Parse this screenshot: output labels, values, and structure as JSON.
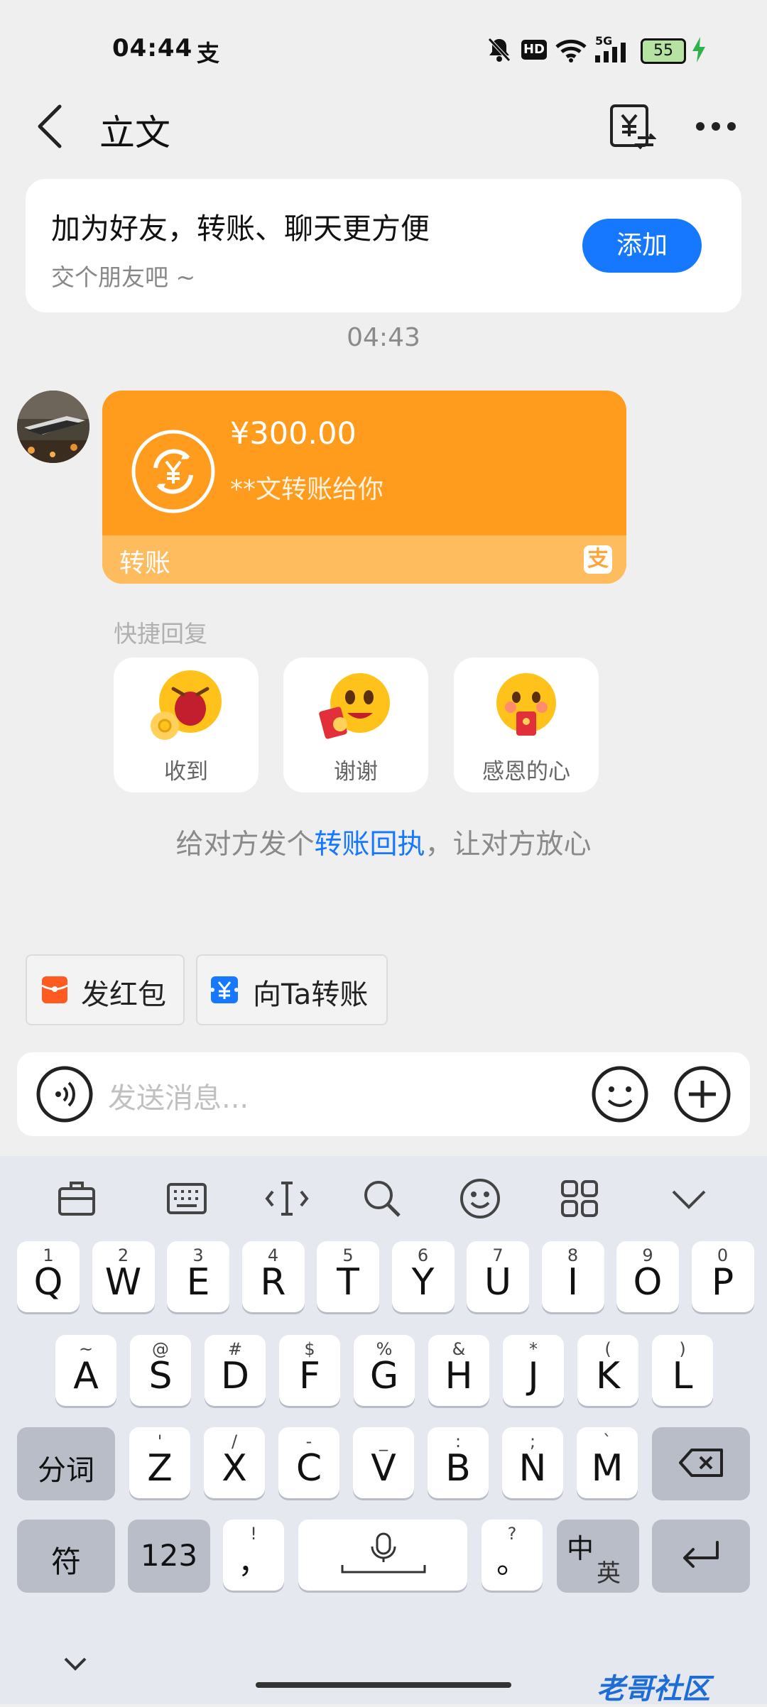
{
  "status_bar": {
    "time": "04:44",
    "alipay_glyph": "支",
    "battery": "55",
    "network": "5G",
    "hd": "HD"
  },
  "header": {
    "title": "立文"
  },
  "add_friend": {
    "title": "加为好友，转账、聊天更方便",
    "subtitle": "交个朋友吧 ~",
    "button": "添加"
  },
  "chat": {
    "timestamp": "04:43",
    "transfer": {
      "amount": "¥300.00",
      "desc": "**文转账给你",
      "label": "转账"
    },
    "quick_reply_label": "快捷回复",
    "quick_replies": [
      "收到",
      "谢谢",
      "感恩的心"
    ],
    "receipt_hint": {
      "before": "给对方发个",
      "link": "转账回执",
      "after": "，让对方放心"
    }
  },
  "actions": {
    "red_packet": "发红包",
    "transfer_to": "向Ta转账"
  },
  "input": {
    "placeholder": "发送消息..."
  },
  "keyboard": {
    "row1": [
      {
        "m": "Q",
        "s": "1"
      },
      {
        "m": "W",
        "s": "2"
      },
      {
        "m": "E",
        "s": "3"
      },
      {
        "m": "R",
        "s": "4"
      },
      {
        "m": "T",
        "s": "5"
      },
      {
        "m": "Y",
        "s": "6"
      },
      {
        "m": "U",
        "s": "7"
      },
      {
        "m": "I",
        "s": "8"
      },
      {
        "m": "O",
        "s": "9"
      },
      {
        "m": "P",
        "s": "0"
      }
    ],
    "row2": [
      {
        "m": "A",
        "s": "~"
      },
      {
        "m": "S",
        "s": "@"
      },
      {
        "m": "D",
        "s": "#"
      },
      {
        "m": "F",
        "s": "$"
      },
      {
        "m": "G",
        "s": "%"
      },
      {
        "m": "H",
        "s": "&"
      },
      {
        "m": "J",
        "s": "*"
      },
      {
        "m": "K",
        "s": "("
      },
      {
        "m": "L",
        "s": ")"
      }
    ],
    "row3": [
      {
        "m": "Z",
        "s": "'"
      },
      {
        "m": "X",
        "s": "/"
      },
      {
        "m": "C",
        "s": "-"
      },
      {
        "m": "V",
        "s": "_"
      },
      {
        "m": "B",
        "s": ":"
      },
      {
        "m": "N",
        "s": ";"
      },
      {
        "m": "M",
        "s": "`"
      }
    ],
    "segment": "分词",
    "symbol": "符",
    "numbers": "123",
    "comma": "，",
    "comma_sub": "!",
    "period": "。",
    "period_sub": "?",
    "lang_top": "中",
    "lang_bottom": "英"
  },
  "watermark": "老哥社区"
}
